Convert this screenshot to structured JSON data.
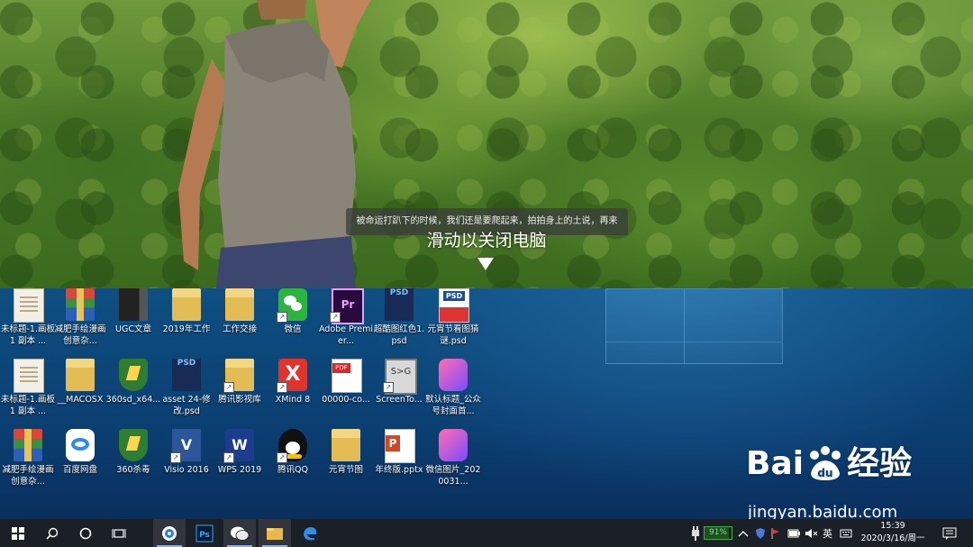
{
  "shutdown": {
    "message": "被命运打趴下的时候，我们还是要爬起来，拍拍身上的土说，再来",
    "slide_label": "滑动以关闭电脑"
  },
  "desktop": {
    "icons": [
      {
        "label": "未标题-1.画板 1 副本 ...",
        "icon": "document-icon",
        "style": "doc",
        "shortcut": false
      },
      {
        "label": "减肥手绘漫画创意杂...",
        "icon": "winrar-archive-icon",
        "style": "rar",
        "shortcut": false
      },
      {
        "label": "UGC文章",
        "icon": "book-folder-icon",
        "style": "book",
        "shortcut": false
      },
      {
        "label": "2019年工作",
        "icon": "folder-icon",
        "style": "folder",
        "shortcut": false
      },
      {
        "label": "工作交接",
        "icon": "folder-icon",
        "style": "folder",
        "shortcut": false
      },
      {
        "label": "微信",
        "icon": "wechat-icon",
        "style": "wechat",
        "shortcut": true
      },
      {
        "label": "Adobe Premier...",
        "icon": "premiere-icon",
        "style": "pr",
        "glyph": "Pr",
        "shortcut": true
      },
      {
        "label": "超酷图红色1.psd",
        "icon": "psd-file-icon",
        "style": "psd",
        "glyph": "PSD",
        "shortcut": false
      },
      {
        "label": "元宵节看图猜谜.psd",
        "icon": "psd-image-icon",
        "style": "psdimg",
        "shortcut": false
      },
      {
        "label": "未标题-1.画板 1 副本 ...",
        "icon": "document-icon",
        "style": "doc",
        "shortcut": false
      },
      {
        "label": "__MACOSX",
        "icon": "folder-icon",
        "style": "folder",
        "shortcut": false
      },
      {
        "label": "360sd_x64...",
        "icon": "360-antivirus-icon",
        "style": "shield",
        "shortcut": false
      },
      {
        "label": "asset 24-修改.psd",
        "icon": "psd-file-icon",
        "style": "psd",
        "glyph": "PSD",
        "shortcut": false
      },
      {
        "label": "腾讯影视库",
        "icon": "folder-icon",
        "style": "folder",
        "shortcut": true
      },
      {
        "label": "XMind 8",
        "icon": "xmind-icon",
        "style": "xmind",
        "glyph": "X",
        "shortcut": true
      },
      {
        "label": "00000-co...",
        "icon": "pdf-file-icon",
        "style": "pdf",
        "shortcut": false
      },
      {
        "label": "ScreenTo...",
        "icon": "screen-to-gif-icon",
        "style": "screen",
        "glyph": "S>G",
        "shortcut": true
      },
      {
        "label": "默认标题_公众号封面首...",
        "icon": "image-file-icon",
        "style": "pink",
        "shortcut": false
      },
      {
        "label": "减肥手绘漫画创意杂...",
        "icon": "winrar-archive-icon",
        "style": "rar",
        "shortcut": false
      },
      {
        "label": "百度网盘",
        "icon": "baidu-netdisk-icon",
        "style": "baidu-pan",
        "shortcut": false
      },
      {
        "label": "360杀毒",
        "icon": "360-antivirus-icon",
        "style": "shield",
        "shortcut": false
      },
      {
        "label": "Visio 2016",
        "icon": "visio-icon",
        "style": "visio",
        "glyph": "V",
        "shortcut": true
      },
      {
        "label": "WPS 2019",
        "icon": "wps-icon",
        "style": "wps",
        "glyph": "W",
        "shortcut": true
      },
      {
        "label": "腾讯QQ",
        "icon": "qq-penguin-icon",
        "style": "qq",
        "shortcut": true
      },
      {
        "label": "元宵节图",
        "icon": "folder-icon",
        "style": "folder",
        "shortcut": false
      },
      {
        "label": "年终版.pptx",
        "icon": "pptx-file-icon",
        "style": "ppt",
        "shortcut": false
      },
      {
        "label": "微信图片_2020031...",
        "icon": "image-file-icon",
        "style": "pink",
        "shortcut": false
      }
    ]
  },
  "watermark": {
    "brand_left": "Bai",
    "brand_right": "经验",
    "url": "jingyan.baidu.com"
  },
  "taskbar": {
    "battery_percent": "91%",
    "ime_label": "英",
    "time": "15:39",
    "date": "2020/3/16/周一"
  }
}
